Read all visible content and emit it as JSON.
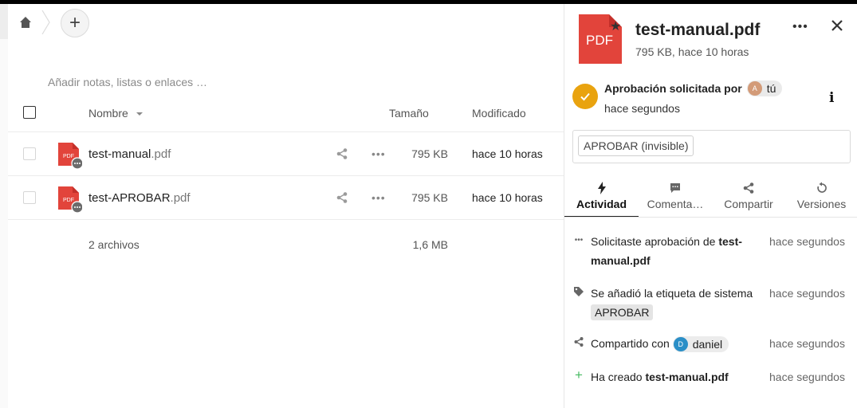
{
  "breadcrumb": {
    "home_icon": "home-icon",
    "add_label": "+"
  },
  "notes_placeholder": "Añadir notas, listas o enlaces …",
  "table": {
    "headers": {
      "name": "Nombre",
      "size": "Tamaño",
      "modified": "Modificado"
    },
    "rows": [
      {
        "name_base": "test-manual",
        "name_ext": ".pdf",
        "size": "795 KB",
        "modified": "hace 10 horas"
      },
      {
        "name_base": "test-APROBAR",
        "name_ext": ".pdf",
        "size": "795 KB",
        "modified": "hace 10 horas"
      }
    ],
    "summary": {
      "count": "2 archivos",
      "total": "1,6 MB"
    }
  },
  "sidebar": {
    "icon_label": "PDF",
    "title": "test-manual.pdf",
    "subtitle": "795 KB, hace 10 horas",
    "approval": {
      "title": "Aprobación solicitada por",
      "user_initial": "A",
      "user": "tú",
      "time": "hace segundos",
      "info_label": "i"
    },
    "tag_chip": "APROBAR (invisible)",
    "tabs": [
      {
        "label": "Actividad",
        "icon": "bolt-icon"
      },
      {
        "label": "Comenta…",
        "icon": "comment-icon"
      },
      {
        "label": "Compartir",
        "icon": "share-icon"
      },
      {
        "label": "Versiones",
        "icon": "history-icon"
      }
    ],
    "activity": [
      {
        "icon": "more-icon",
        "text_pre": "Solicitaste aprobación de ",
        "bold": "test-manual.pdf",
        "time": "hace segundos"
      },
      {
        "icon": "tag-icon",
        "text_pre": "Se añadió la etiqueta de sistema ",
        "tag": "APROBAR",
        "time": "hace segundos"
      },
      {
        "icon": "share-icon",
        "text_pre": "Compartido con ",
        "user_initial": "D",
        "user": "daniel",
        "time": "hace segundos"
      },
      {
        "icon": "plus-icon",
        "text_pre": "Ha creado ",
        "bold": "test-manual.pdf",
        "time": "hace segundos"
      }
    ]
  },
  "colors": {
    "pdf_red": "#e2443b",
    "approval_orange": "#e9a30f",
    "avatar_a": "#d39b78",
    "avatar_d": "#2b8fc7",
    "create_green": "#46ba61"
  }
}
